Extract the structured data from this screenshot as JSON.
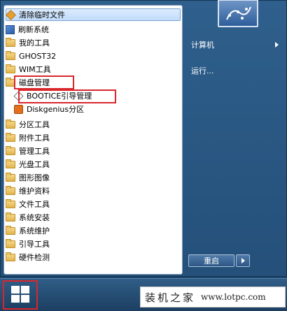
{
  "menu": {
    "items": [
      {
        "label": "清除临时文件",
        "icon": "cleanup-icon",
        "highlighted": true
      },
      {
        "label": "刷新系统",
        "icon": "system-refresh-icon"
      },
      {
        "label": "我的工具",
        "icon": "folder-icon"
      },
      {
        "label": "GHOST32",
        "icon": "folder-icon"
      },
      {
        "label": "WIM工具",
        "icon": "folder-icon"
      },
      {
        "label": "磁盘管理",
        "icon": "folder-open-icon"
      },
      {
        "label": "BOOTICE引导管理",
        "icon": "bootice-icon"
      },
      {
        "label": "Diskgenius分区",
        "icon": "diskgenius-icon"
      },
      {
        "label": "分区工具",
        "icon": "folder-icon"
      },
      {
        "label": "附件工具",
        "icon": "folder-icon"
      },
      {
        "label": "管理工具",
        "icon": "folder-icon"
      },
      {
        "label": "光盘工具",
        "icon": "folder-icon"
      },
      {
        "label": "图形图像",
        "icon": "folder-icon"
      },
      {
        "label": "维护资料",
        "icon": "folder-icon"
      },
      {
        "label": "文件工具",
        "icon": "folder-icon"
      },
      {
        "label": "系统安装",
        "icon": "folder-icon"
      },
      {
        "label": "系统维护",
        "icon": "folder-icon"
      },
      {
        "label": "引导工具",
        "icon": "folder-icon"
      },
      {
        "label": "硬件检测",
        "icon": "folder-icon"
      }
    ]
  },
  "right": {
    "computer_label": "计算机",
    "run_label": "运行...",
    "restart_label": "重启"
  },
  "watermark": {
    "chinese": "装机之家",
    "url": "www.lotpc.com"
  }
}
